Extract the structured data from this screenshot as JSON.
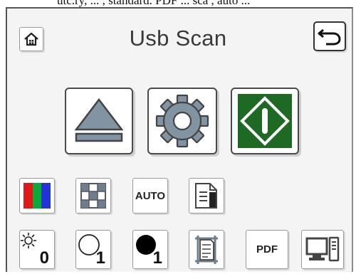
{
  "screen": {
    "title": "Usb Scan",
    "top_cut_text": "utc.ry, ... , standard. PDF ... sca , auto ...",
    "buttons": {
      "home": "home-icon",
      "back": "back-arrow-icon",
      "eject": "eject-icon",
      "settings": "gear-icon",
      "start": "start-scan-icon"
    },
    "options_row1": [
      {
        "name": "color-mode",
        "icon": "color-rgb-icon"
      },
      {
        "name": "resolution",
        "icon": "grid-icon"
      },
      {
        "name": "auto",
        "label": "AUTO"
      },
      {
        "name": "document",
        "icon": "document-icon"
      }
    ],
    "options_row2": [
      {
        "name": "brightness",
        "value": "0"
      },
      {
        "name": "contrast-light",
        "value": "1"
      },
      {
        "name": "contrast-dark",
        "value": "1"
      },
      {
        "name": "frame",
        "icon": "page-frame-icon"
      },
      {
        "name": "file-format",
        "label": "PDF"
      },
      {
        "name": "destination",
        "icon": "computer-icon"
      }
    ],
    "colors": {
      "start_green": "#1e6a25",
      "red": "#e01818",
      "green": "#0aa93a",
      "blue": "#2233d8"
    }
  }
}
